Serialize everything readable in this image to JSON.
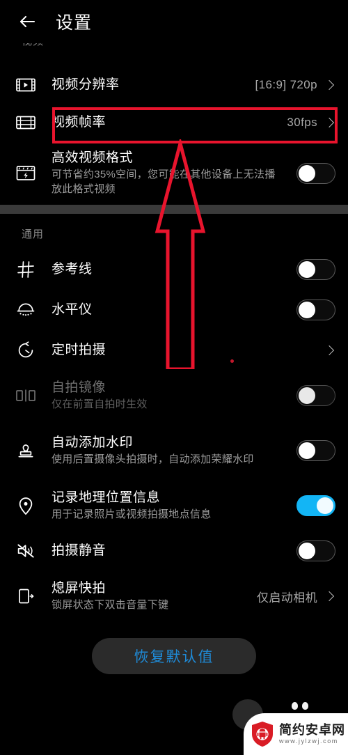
{
  "header": {
    "title": "设置",
    "back_icon": "back-arrow-icon"
  },
  "sections": [
    {
      "label": "视频",
      "label_clipped": true,
      "items": [
        {
          "icon": "video-resolution-icon",
          "title": "视频分辨率",
          "subtitle": "",
          "value": "[16:9] 720p",
          "control": "chevron",
          "dim": false
        },
        {
          "icon": "video-framerate-icon",
          "title": "视频帧率",
          "subtitle": "",
          "value": "30fps",
          "control": "chevron",
          "dim": false,
          "highlighted": true
        },
        {
          "icon": "efficient-video-format-icon",
          "title": "高效视频格式",
          "subtitle": "可节省约35%空间，您可能在其他设备上无法播放此格式视频",
          "value": "",
          "control": "toggle",
          "toggle_on": false,
          "dim": false
        }
      ]
    },
    {
      "label": "通用",
      "label_clipped": false,
      "items": [
        {
          "icon": "grid-lines-icon",
          "title": "参考线",
          "subtitle": "",
          "value": "",
          "control": "toggle",
          "toggle_on": false,
          "dim": false
        },
        {
          "icon": "level-meter-icon",
          "title": "水平仪",
          "subtitle": "",
          "value": "",
          "control": "toggle",
          "toggle_on": false,
          "dim": false
        },
        {
          "icon": "timer-icon",
          "title": "定时拍摄",
          "subtitle": "",
          "value": "",
          "control": "chevron",
          "dim": false
        },
        {
          "icon": "mirror-selfie-icon",
          "title": "自拍镜像",
          "subtitle": "仅在前置自拍时生效",
          "value": "",
          "control": "toggle",
          "toggle_on": false,
          "dim": true
        },
        {
          "icon": "watermark-stamp-icon",
          "title": "自动添加水印",
          "subtitle": "使用后置摄像头拍摄时，自动添加荣耀水印",
          "value": "",
          "control": "toggle",
          "toggle_on": false,
          "dim": false
        },
        {
          "icon": "location-pin-icon",
          "title": "记录地理位置信息",
          "subtitle": "用于记录照片或视频拍摄地点信息",
          "value": "",
          "control": "toggle",
          "toggle_on": true,
          "dim": false
        },
        {
          "icon": "mute-speaker-icon",
          "title": "拍摄静音",
          "subtitle": "",
          "value": "",
          "control": "toggle",
          "toggle_on": false,
          "dim": false
        },
        {
          "icon": "screen-off-quick-capture-icon",
          "title": "熄屏快拍",
          "subtitle": "锁屏状态下双击音量下键",
          "value": "仅启动相机",
          "control": "chevron",
          "dim": false
        }
      ]
    }
  ],
  "restore_button": {
    "label": "恢复默认值"
  },
  "annotations": {
    "highlight_color": "#e8142d",
    "arrow_color": "#e8142d",
    "arrow_name": "red-up-arrow-annotation",
    "highlight_target": "视频帧率"
  },
  "watermark": {
    "name": "简约安卓网",
    "url": "www.jylzwj.com",
    "logo": "android-shield-logo"
  },
  "colors": {
    "background": "#000000",
    "toggle_on": "#13b5f5",
    "restore_text": "#1f8ad6",
    "accent_red": "#e8142d"
  }
}
